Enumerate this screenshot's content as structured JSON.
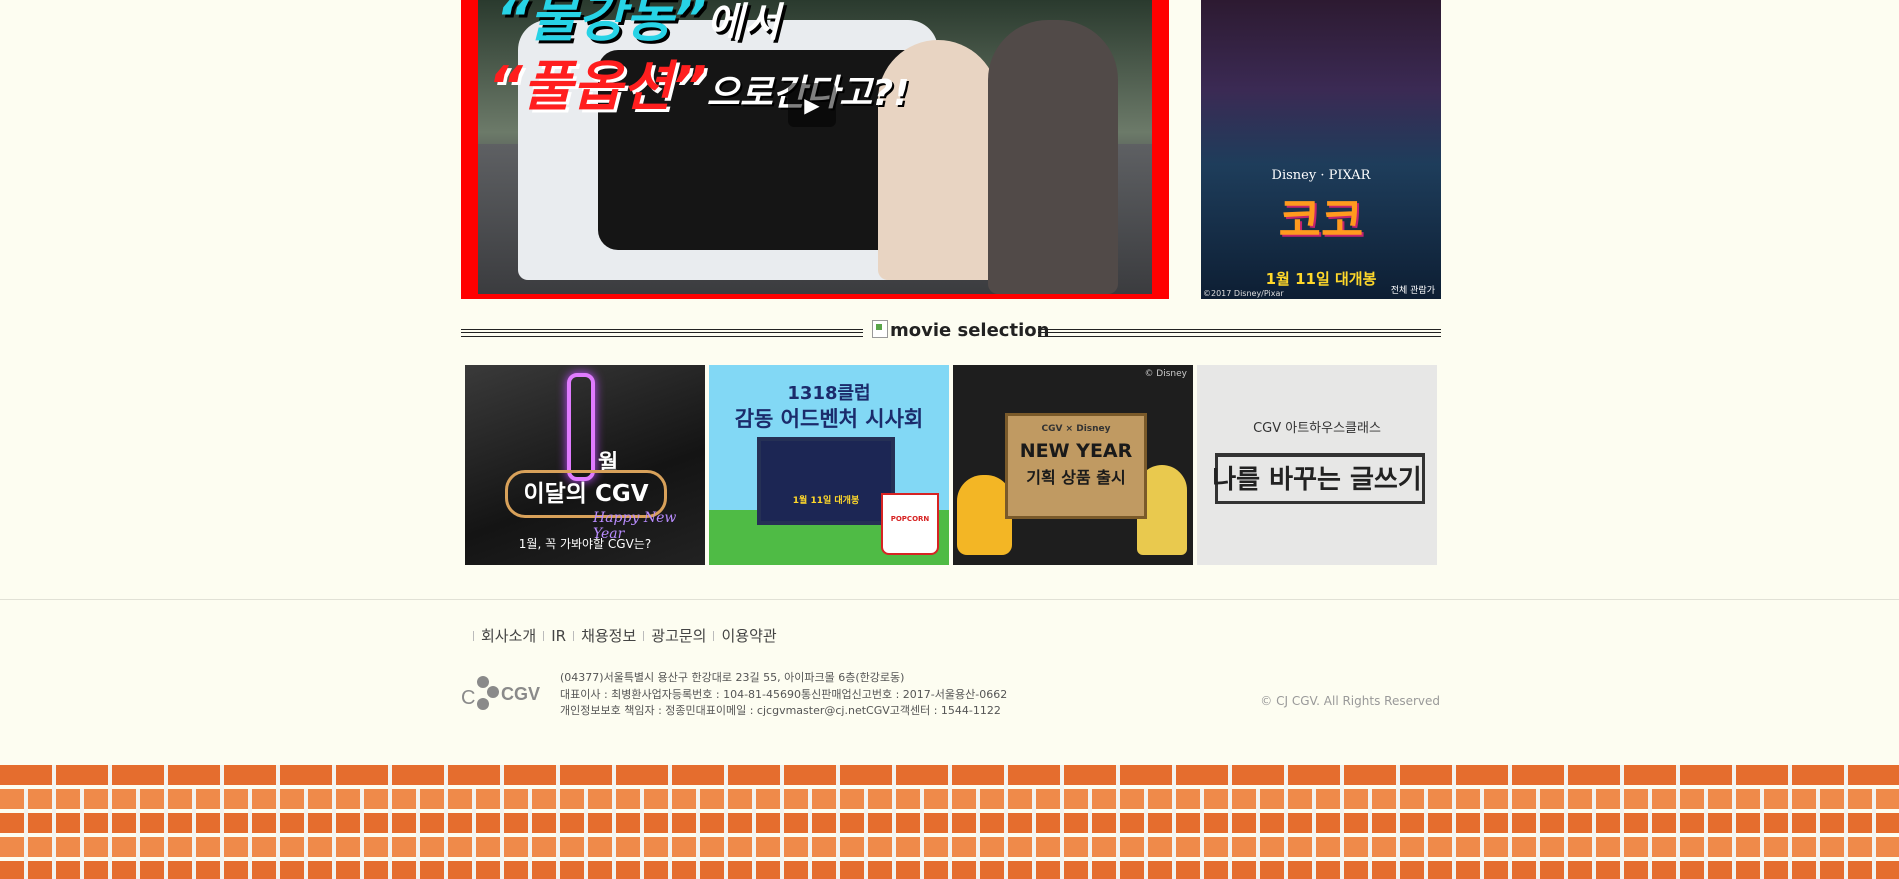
{
  "video": {
    "headline1_main": "“물강동”",
    "headline1_suffix": "에서",
    "headline2_main": "“풀옵션”",
    "headline2_suffix": "으로간다고?!",
    "play_symbol": "▶"
  },
  "poster": {
    "brand": "Disney · PIXAR",
    "title": "코코",
    "release": "1월 11일 대개봉",
    "copyright": "©2017 Disney/Pixar",
    "rating": "전체 관람가"
  },
  "section": {
    "title": "movie selection"
  },
  "banners": [
    {
      "month_numeral": "1",
      "month": "월",
      "sign": "이달의 CGV",
      "script": "Happy New Year",
      "caption": "1월, 꼭 가봐야할 CGV는?"
    },
    {
      "club": "1318클럽",
      "title": "감동 어드벤처 시사회",
      "screen_text": "1월 11일 대개봉",
      "popcorn": "POPCORN"
    },
    {
      "disney": "© Disney",
      "brand": "CGV × Disney",
      "title1": "NEW YEAR",
      "title2": "기획 상품 출시"
    },
    {
      "brand": "CGV 아트하우스클래스",
      "title": "나를 바꾸는 글쓰기"
    }
  ],
  "footer": {
    "nav": [
      "회사소개",
      "IR",
      "채용정보",
      "광고문의",
      "이용약관"
    ],
    "logo_text": "CJ CGV",
    "address_lines": [
      "(04377)서울특별시 용산구 한강대로 23길 55, 아이파크몰 6층(한강로동)",
      "대표이사 : 최병환사업자등록번호 : 104-81-45690통신판매업신고번호 : 2017-서울용산-0662",
      "개인정보보호 책임자 : 정종민대표이메일 : cjcgvmaster@cj.netCGV고객센터 : 1544-1122"
    ],
    "copyright": "© CJ CGV. All Rights Reserved"
  }
}
